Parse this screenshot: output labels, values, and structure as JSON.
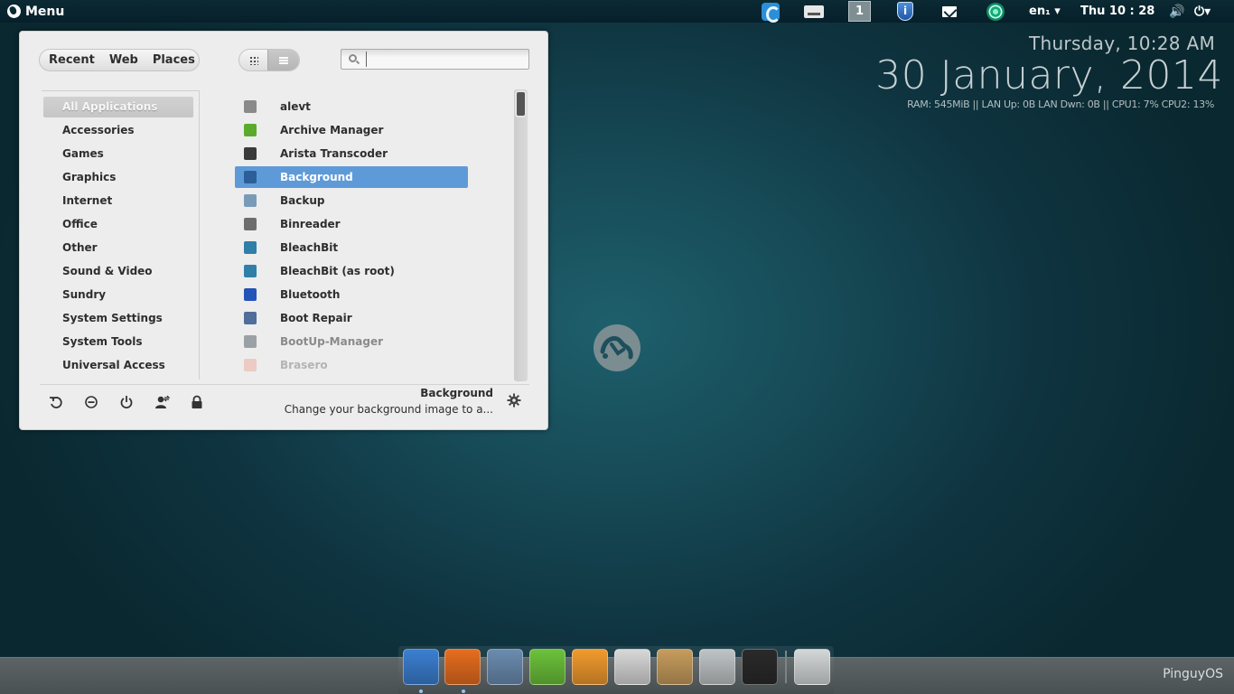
{
  "top_panel": {
    "menu_label": "Menu",
    "workspace_number": "1",
    "keyboard_layout": "en₁ ▾",
    "clock": "Thu 10 : 28"
  },
  "desktop_info": {
    "day_time": "Thursday, 10:28 AM",
    "date": "30 January, 2014",
    "stats": "RAM: 545MiB || LAN Up: 0B  LAN Dwn: 0B  || CPU1: 7% CPU2: 13%"
  },
  "menu": {
    "sources": [
      "Recent",
      "Web",
      "Places"
    ],
    "search_placeholder": "",
    "categories": [
      {
        "label": "All Applications",
        "active": true
      },
      {
        "label": "Accessories"
      },
      {
        "label": "Games"
      },
      {
        "label": "Graphics"
      },
      {
        "label": "Internet"
      },
      {
        "label": "Office"
      },
      {
        "label": "Other"
      },
      {
        "label": "Sound & Video"
      },
      {
        "label": "Sundry"
      },
      {
        "label": "System Settings"
      },
      {
        "label": "System Tools"
      },
      {
        "label": "Universal Access"
      }
    ],
    "apps": [
      {
        "label": "alevt",
        "icon": "gear-icon",
        "color": "#8a8a8a"
      },
      {
        "label": "Archive Manager",
        "icon": "archive-icon",
        "color": "#5aab2b"
      },
      {
        "label": "Arista Transcoder",
        "icon": "transcoder-icon",
        "color": "#3a3a3a"
      },
      {
        "label": "Background",
        "icon": "background-icon",
        "color": "#2c5f99",
        "selected": true
      },
      {
        "label": "Backup",
        "icon": "backup-icon",
        "color": "#7a9bb8"
      },
      {
        "label": "Binreader",
        "icon": "binreader-icon",
        "color": "#6d6d6d"
      },
      {
        "label": "BleachBit",
        "icon": "bleachbit-icon",
        "color": "#2f7fa8"
      },
      {
        "label": "BleachBit (as root)",
        "icon": "bleachbit-icon",
        "color": "#2f7fa8"
      },
      {
        "label": "Bluetooth",
        "icon": "bluetooth-icon",
        "color": "#2254b8"
      },
      {
        "label": "Boot Repair",
        "icon": "boot-repair-icon",
        "color": "#4f6e9a"
      },
      {
        "label": "BootUp-Manager",
        "icon": "bootup-manager-icon",
        "color": "#9aa0a6",
        "faded": 1
      },
      {
        "label": "Brasero",
        "icon": "brasero-icon",
        "color": "#e9b4a8",
        "faded": 2
      }
    ],
    "description_title": "Background",
    "description_text": "Change your background image to a..."
  },
  "dock": {
    "apps": [
      {
        "name": "anchor",
        "color": "#3b7fd0"
      },
      {
        "name": "firefox",
        "color": "#e66d1f"
      },
      {
        "name": "thunderbird",
        "color": "#6b8cb0"
      },
      {
        "name": "hexchat",
        "color": "#6cc13b"
      },
      {
        "name": "software-center",
        "color": "#f19a2e"
      },
      {
        "name": "video",
        "color": "#d8d8d8"
      },
      {
        "name": "archive",
        "color": "#c69c5d"
      },
      {
        "name": "mixer",
        "color": "#bfc4c6"
      },
      {
        "name": "terminal",
        "color": "#2a2a2a"
      },
      {
        "name": "trash",
        "color": "#d4d7d8"
      }
    ],
    "brand": "PinguyOS"
  }
}
